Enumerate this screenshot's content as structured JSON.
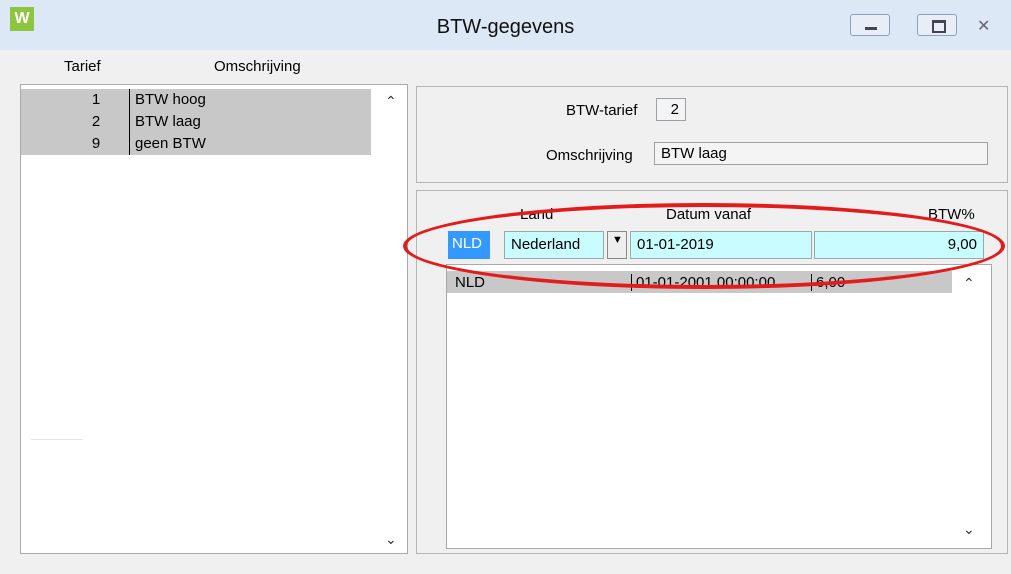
{
  "window": {
    "title": "BTW-gegevens",
    "app_icon_letter": "W",
    "icons": {
      "minimize": "minimize-icon",
      "maximize": "maximize-icon",
      "close": "close-icon"
    }
  },
  "list": {
    "headers": {
      "tarief": "Tarief",
      "omschrijving": "Omschrijving"
    },
    "rows": [
      {
        "nr": "1",
        "desc": "BTW hoog"
      },
      {
        "nr": "2",
        "desc": "BTW laag"
      },
      {
        "nr": "9",
        "desc": "geen BTW"
      }
    ]
  },
  "detail": {
    "tarief_label": "BTW-tarief",
    "tarief_value": "2",
    "omschrijving_label": "Omschrijving",
    "omschrijving_value": "BTW laag"
  },
  "rates": {
    "headers": {
      "land": "Land",
      "datum": "Datum vanaf",
      "pct": "BTW%"
    },
    "edit_row": {
      "code": "NLD",
      "land": "Nederland",
      "datum": "01-01-2019",
      "pct": "9,00"
    },
    "grid_rows": [
      {
        "code": "NLD",
        "datum": "01-01-2001 00:00:00",
        "pct": "6,00"
      }
    ]
  },
  "colors": {
    "selection": "#3399ff",
    "edit_cell": "#c8fcff",
    "row_bg": "#c8c8c8",
    "highlight": "#e31b1b"
  }
}
